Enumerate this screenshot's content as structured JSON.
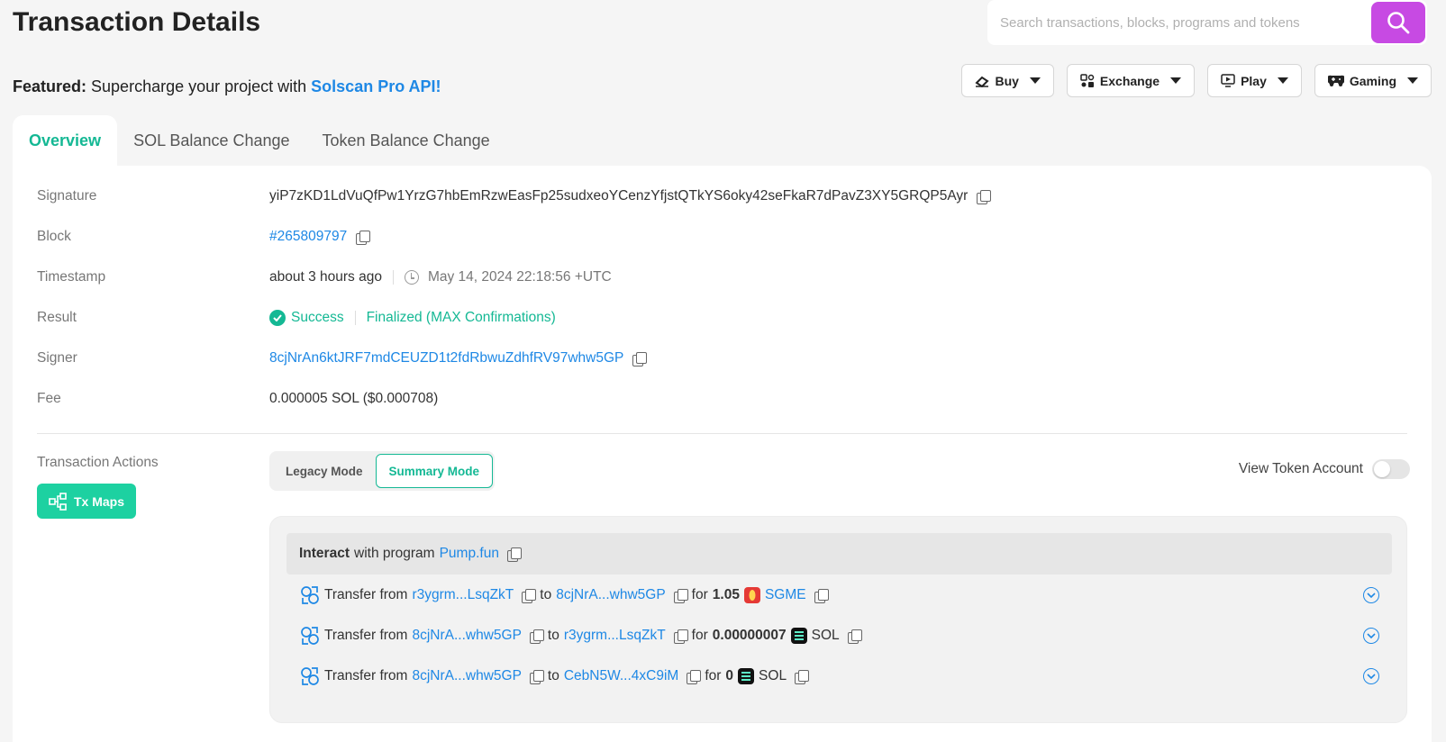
{
  "header": {
    "title": "Transaction Details",
    "search_placeholder": "Search transactions, blocks, programs and tokens",
    "featured_label": "Featured:",
    "featured_text": "Supercharge your project with",
    "featured_link": "Solscan Pro API!"
  },
  "top_buttons": [
    {
      "label": "Buy",
      "icon": "buy-icon"
    },
    {
      "label": "Exchange",
      "icon": "exchange-icon"
    },
    {
      "label": "Play",
      "icon": "play-icon"
    },
    {
      "label": "Gaming",
      "icon": "gamepad-icon"
    }
  ],
  "tabs": [
    {
      "label": "Overview",
      "active": true
    },
    {
      "label": "SOL Balance Change",
      "active": false
    },
    {
      "label": "Token Balance Change",
      "active": false
    }
  ],
  "details": {
    "signature_label": "Signature",
    "signature": "yiP7zKD1LdVuQfPw1YrzG7hbEmRzwEasFp25sudxeoYCenzYfjstQTkYS6oky42seFkaR7dPavZ3XY5GRQP5Ayr",
    "block_label": "Block",
    "block": "#265809797",
    "timestamp_label": "Timestamp",
    "timestamp_relative": "about 3 hours ago",
    "timestamp_absolute": "May 14, 2024 22:18:56 +UTC",
    "result_label": "Result",
    "result_status": "Success",
    "result_finality": "Finalized (MAX Confirmations)",
    "signer_label": "Signer",
    "signer": "8cjNrAn6ktJRF7mdCEUZD1t2fdRbwuZdhfRV97whw5GP",
    "fee_label": "Fee",
    "fee": "0.000005 SOL ($0.000708)"
  },
  "actions": {
    "label": "Transaction Actions",
    "tx_maps_label": "Tx Maps",
    "legacy_mode": "Legacy Mode",
    "summary_mode": "Summary Mode",
    "view_token_account": "View Token Account",
    "interact_prefix": "Interact",
    "interact_text": "with program",
    "program": "Pump.fun",
    "transfers": [
      {
        "from": "r3ygrm...LsqZkT",
        "to": "8cjNrA...whw5GP",
        "amount": "1.05",
        "token": "SGME",
        "token_is_link": true
      },
      {
        "from": "8cjNrA...whw5GP",
        "to": "r3ygrm...LsqZkT",
        "amount": "0.00000007",
        "token": "SOL",
        "token_is_link": false
      },
      {
        "from": "8cjNrA...whw5GP",
        "to": "CebN5W...4xC9iM",
        "amount": "0",
        "token": "SOL",
        "token_is_link": false
      }
    ],
    "transfer_word": "Transfer from",
    "to_word": "to",
    "for_word": "for"
  },
  "colors": {
    "accent": "#14b894",
    "link": "#1e88e5",
    "search_button": "#c74ae3",
    "tx_maps": "#1dd1a1"
  }
}
